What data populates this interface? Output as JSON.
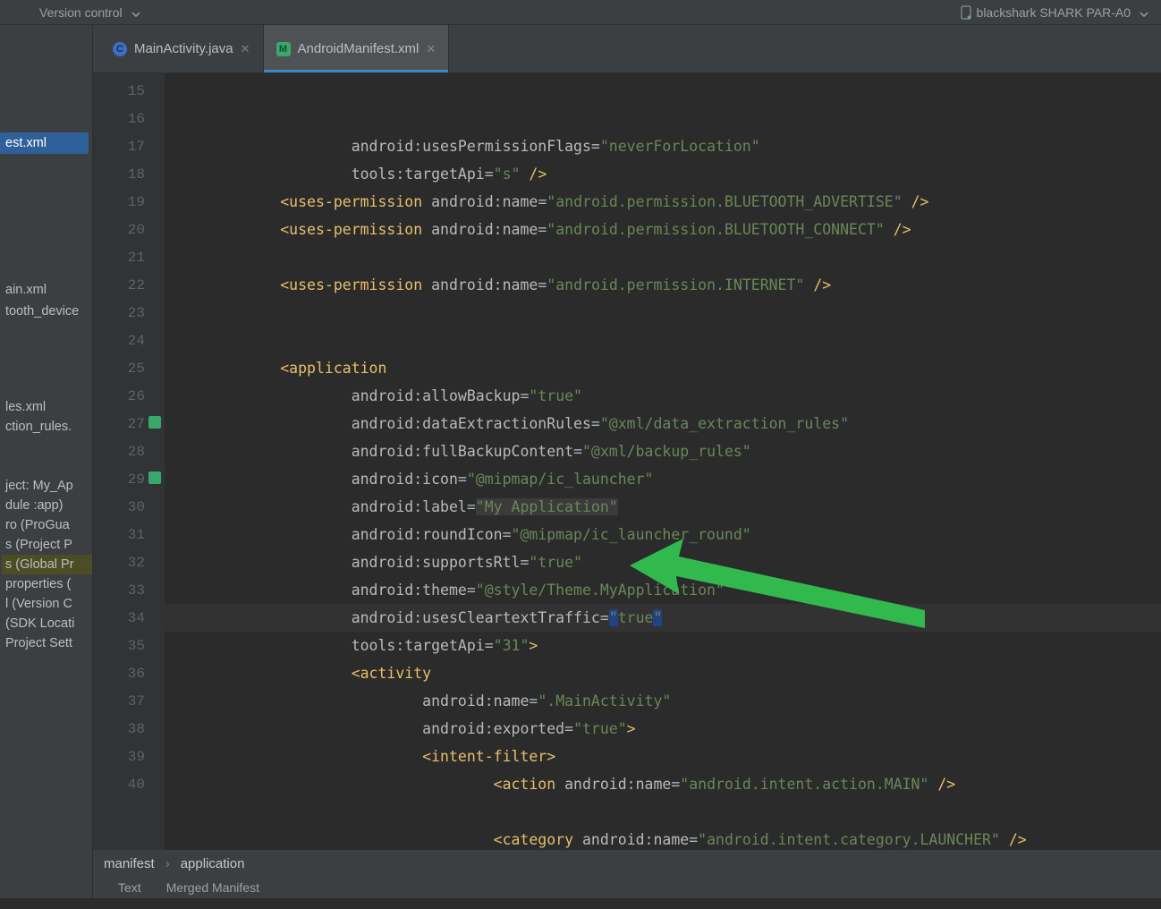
{
  "toolbar": {
    "version_control": "Version control",
    "device": "blackshark SHARK PAR-A0"
  },
  "tabs": [
    {
      "label": "MainActivity.java",
      "icon": "C",
      "active": false
    },
    {
      "label": "AndroidManifest.xml",
      "icon": "M",
      "active": true
    }
  ],
  "sidebar": {
    "selected_file": "est.xml",
    "files": [
      "ain.xml",
      "tooth_device"
    ],
    "lower": [
      "les.xml",
      "ction_rules.",
      "",
      "",
      "ject: My_Ap",
      "dule :app)",
      "ro (ProGua",
      "s (Project P",
      "s (Global Pr",
      "properties (",
      "l (Version C",
      "(SDK Locati",
      "Project Sett"
    ],
    "lower_highlight_idx": 8
  },
  "gutter": {
    "start": 15,
    "end": 40,
    "icon_lines": [
      27,
      29
    ]
  },
  "code_lines": [
    {
      "indent": 5,
      "parts": [
        {
          "cls": "c-ns",
          "t": "android"
        },
        {
          "cls": "c-eq",
          "t": ":"
        },
        {
          "cls": "c-attr",
          "t": "usesPermissionFlags"
        },
        {
          "cls": "c-eq",
          "t": "="
        },
        {
          "cls": "c-val",
          "t": "\"neverForLocation\""
        }
      ]
    },
    {
      "indent": 5,
      "parts": [
        {
          "cls": "c-ns",
          "t": "tools"
        },
        {
          "cls": "c-eq",
          "t": ":"
        },
        {
          "cls": "c-attr",
          "t": "targetApi"
        },
        {
          "cls": "c-eq",
          "t": "="
        },
        {
          "cls": "c-val",
          "t": "\"s\""
        },
        {
          "cls": "",
          "t": " "
        },
        {
          "cls": "c-punc",
          "t": "/>"
        }
      ]
    },
    {
      "indent": 3,
      "parts": [
        {
          "cls": "c-punc",
          "t": "<"
        },
        {
          "cls": "c-tag",
          "t": "uses-permission"
        },
        {
          "cls": "",
          "t": " "
        },
        {
          "cls": "c-ns",
          "t": "android"
        },
        {
          "cls": "c-eq",
          "t": ":"
        },
        {
          "cls": "c-attr",
          "t": "name"
        },
        {
          "cls": "c-eq",
          "t": "="
        },
        {
          "cls": "c-val",
          "t": "\"android.permission.BLUETOOTH_ADVERTISE\""
        },
        {
          "cls": "",
          "t": " "
        },
        {
          "cls": "c-punc",
          "t": "/>"
        }
      ]
    },
    {
      "indent": 3,
      "parts": [
        {
          "cls": "c-punc",
          "t": "<"
        },
        {
          "cls": "c-tag",
          "t": "uses-permission"
        },
        {
          "cls": "",
          "t": " "
        },
        {
          "cls": "c-ns",
          "t": "android"
        },
        {
          "cls": "c-eq",
          "t": ":"
        },
        {
          "cls": "c-attr",
          "t": "name"
        },
        {
          "cls": "c-eq",
          "t": "="
        },
        {
          "cls": "c-val",
          "t": "\"android.permission.BLUETOOTH_CONNECT\""
        },
        {
          "cls": "",
          "t": " "
        },
        {
          "cls": "c-punc",
          "t": "/>"
        }
      ]
    },
    {
      "indent": 0,
      "parts": []
    },
    {
      "indent": 3,
      "parts": [
        {
          "cls": "c-punc",
          "t": "<"
        },
        {
          "cls": "c-tag",
          "t": "uses-permission"
        },
        {
          "cls": "",
          "t": " "
        },
        {
          "cls": "c-ns",
          "t": "android"
        },
        {
          "cls": "c-eq",
          "t": ":"
        },
        {
          "cls": "c-attr",
          "t": "name"
        },
        {
          "cls": "c-eq",
          "t": "="
        },
        {
          "cls": "c-val",
          "t": "\"android.permission.INTERNET\""
        },
        {
          "cls": "",
          "t": " "
        },
        {
          "cls": "c-punc",
          "t": "/>"
        }
      ]
    },
    {
      "indent": 0,
      "parts": []
    },
    {
      "indent": 0,
      "parts": []
    },
    {
      "indent": 3,
      "parts": [
        {
          "cls": "c-punc",
          "t": "<"
        },
        {
          "cls": "c-tag",
          "t": "application"
        }
      ]
    },
    {
      "indent": 5,
      "parts": [
        {
          "cls": "c-ns",
          "t": "android"
        },
        {
          "cls": "c-eq",
          "t": ":"
        },
        {
          "cls": "c-attr",
          "t": "allowBackup"
        },
        {
          "cls": "c-eq",
          "t": "="
        },
        {
          "cls": "c-val",
          "t": "\"true\""
        }
      ]
    },
    {
      "indent": 5,
      "parts": [
        {
          "cls": "c-ns",
          "t": "android"
        },
        {
          "cls": "c-eq",
          "t": ":"
        },
        {
          "cls": "c-attr",
          "t": "dataExtractionRules"
        },
        {
          "cls": "c-eq",
          "t": "="
        },
        {
          "cls": "c-ref",
          "t": "\"@xml/data_extraction_rules\""
        }
      ]
    },
    {
      "indent": 5,
      "parts": [
        {
          "cls": "c-ns",
          "t": "android"
        },
        {
          "cls": "c-eq",
          "t": ":"
        },
        {
          "cls": "c-attr",
          "t": "fullBackupContent"
        },
        {
          "cls": "c-eq",
          "t": "="
        },
        {
          "cls": "c-ref",
          "t": "\"@xml/backup_rules\""
        }
      ]
    },
    {
      "indent": 5,
      "parts": [
        {
          "cls": "c-ns",
          "t": "android"
        },
        {
          "cls": "c-eq",
          "t": ":"
        },
        {
          "cls": "c-attr",
          "t": "icon"
        },
        {
          "cls": "c-eq",
          "t": "="
        },
        {
          "cls": "c-ref",
          "t": "\"@mipmap/ic_launcher\""
        }
      ]
    },
    {
      "indent": 5,
      "parts": [
        {
          "cls": "c-ns",
          "t": "android"
        },
        {
          "cls": "c-eq",
          "t": ":"
        },
        {
          "cls": "c-attr",
          "t": "label"
        },
        {
          "cls": "c-eq",
          "t": "="
        },
        {
          "cls": "c-val hl-label",
          "t": "\"My Application\""
        }
      ]
    },
    {
      "indent": 5,
      "parts": [
        {
          "cls": "c-ns",
          "t": "android"
        },
        {
          "cls": "c-eq",
          "t": ":"
        },
        {
          "cls": "c-attr",
          "t": "roundIcon"
        },
        {
          "cls": "c-eq",
          "t": "="
        },
        {
          "cls": "c-ref",
          "t": "\"@mipmap/ic_launcher_round\""
        }
      ]
    },
    {
      "indent": 5,
      "parts": [
        {
          "cls": "c-ns",
          "t": "android"
        },
        {
          "cls": "c-eq",
          "t": ":"
        },
        {
          "cls": "c-attr",
          "t": "supportsRtl"
        },
        {
          "cls": "c-eq",
          "t": "="
        },
        {
          "cls": "c-val",
          "t": "\"true\""
        }
      ]
    },
    {
      "indent": 5,
      "parts": [
        {
          "cls": "c-ns",
          "t": "android"
        },
        {
          "cls": "c-eq",
          "t": ":"
        },
        {
          "cls": "c-attr",
          "t": "theme"
        },
        {
          "cls": "c-eq",
          "t": "="
        },
        {
          "cls": "c-ref",
          "t": "\"@style/Theme.MyApplication\""
        }
      ]
    },
    {
      "indent": 5,
      "current": true,
      "parts": [
        {
          "cls": "c-ns",
          "t": "android"
        },
        {
          "cls": "c-eq",
          "t": ":"
        },
        {
          "cls": "c-attr",
          "t": "usesCleartextTraffic"
        },
        {
          "cls": "c-eq",
          "t": "="
        },
        {
          "cls": "c-val hl-q",
          "t": "\""
        },
        {
          "cls": "c-val",
          "t": "true"
        },
        {
          "cls": "c-val hl-q",
          "t": "\""
        }
      ]
    },
    {
      "indent": 5,
      "parts": [
        {
          "cls": "c-ns",
          "t": "tools"
        },
        {
          "cls": "c-eq",
          "t": ":"
        },
        {
          "cls": "c-attr",
          "t": "targetApi"
        },
        {
          "cls": "c-eq",
          "t": "="
        },
        {
          "cls": "c-val",
          "t": "\"31\""
        },
        {
          "cls": "c-punc",
          "t": ">"
        }
      ]
    },
    {
      "indent": 5,
      "parts": [
        {
          "cls": "c-punc",
          "t": "<"
        },
        {
          "cls": "c-tag",
          "t": "activity"
        }
      ]
    },
    {
      "indent": 7,
      "parts": [
        {
          "cls": "c-ns",
          "t": "android"
        },
        {
          "cls": "c-eq",
          "t": ":"
        },
        {
          "cls": "c-attr",
          "t": "name"
        },
        {
          "cls": "c-eq",
          "t": "="
        },
        {
          "cls": "c-val",
          "t": "\".MainActivity\""
        }
      ]
    },
    {
      "indent": 7,
      "parts": [
        {
          "cls": "c-ns",
          "t": "android"
        },
        {
          "cls": "c-eq",
          "t": ":"
        },
        {
          "cls": "c-attr",
          "t": "exported"
        },
        {
          "cls": "c-eq",
          "t": "="
        },
        {
          "cls": "c-val",
          "t": "\"true\""
        },
        {
          "cls": "c-punc",
          "t": ">"
        }
      ]
    },
    {
      "indent": 7,
      "parts": [
        {
          "cls": "c-punc",
          "t": "<"
        },
        {
          "cls": "c-tag",
          "t": "intent-filter"
        },
        {
          "cls": "c-punc",
          "t": ">"
        }
      ]
    },
    {
      "indent": 9,
      "parts": [
        {
          "cls": "c-punc",
          "t": "<"
        },
        {
          "cls": "c-tag",
          "t": "action"
        },
        {
          "cls": "",
          "t": " "
        },
        {
          "cls": "c-ns",
          "t": "android"
        },
        {
          "cls": "c-eq",
          "t": ":"
        },
        {
          "cls": "c-attr",
          "t": "name"
        },
        {
          "cls": "c-eq",
          "t": "="
        },
        {
          "cls": "c-val",
          "t": "\"android.intent.action.MAIN\""
        },
        {
          "cls": "",
          "t": " "
        },
        {
          "cls": "c-punc",
          "t": "/>"
        }
      ]
    },
    {
      "indent": 0,
      "parts": []
    },
    {
      "indent": 9,
      "parts": [
        {
          "cls": "c-punc",
          "t": "<"
        },
        {
          "cls": "c-tag",
          "t": "category"
        },
        {
          "cls": "",
          "t": " "
        },
        {
          "cls": "c-ns",
          "t": "android"
        },
        {
          "cls": "c-eq",
          "t": ":"
        },
        {
          "cls": "c-attr",
          "t": "name"
        },
        {
          "cls": "c-eq",
          "t": "="
        },
        {
          "cls": "c-val",
          "t": "\"android.intent.category.LAUNCHER\""
        },
        {
          "cls": "",
          "t": " "
        },
        {
          "cls": "c-punc",
          "t": "/>"
        }
      ]
    }
  ],
  "breadcrumb": [
    "manifest",
    "application"
  ],
  "view_tabs": [
    "Text",
    "Merged Manifest"
  ]
}
